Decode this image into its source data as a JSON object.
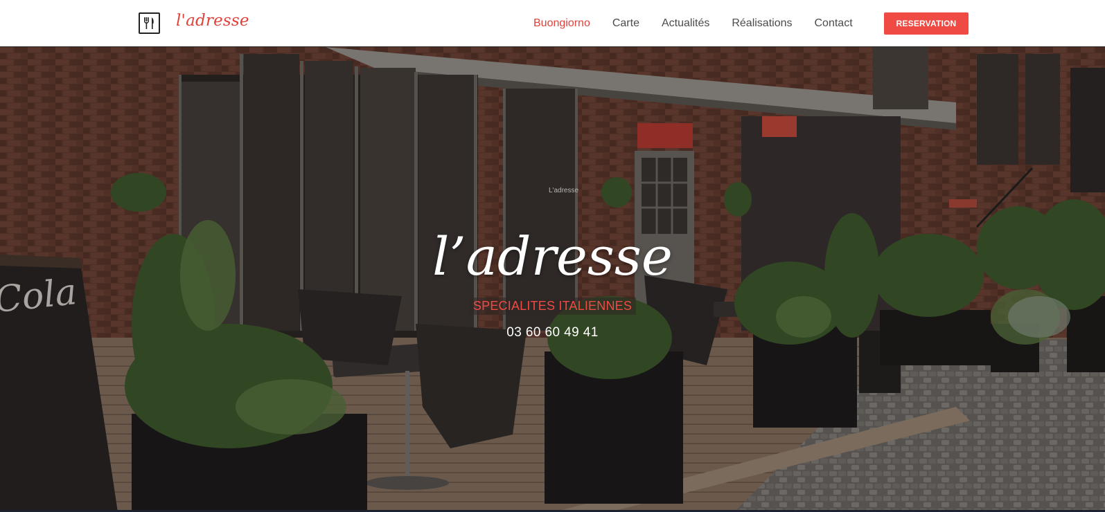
{
  "brand": {
    "name": "l'adresse",
    "logo_icon": "fork-knife-icon",
    "accent_color": "#ef4a43"
  },
  "nav": {
    "items": [
      {
        "label": "Buongiorno",
        "active": true
      },
      {
        "label": "Carte",
        "active": false
      },
      {
        "label": "Actualités",
        "active": false
      },
      {
        "label": "Réalisations",
        "active": false
      },
      {
        "label": "Contact",
        "active": false
      }
    ],
    "cta_label": "RESERVATION"
  },
  "hero": {
    "title": "l’adresse",
    "subtitle": "SPECIALITES ITALIENNES",
    "phone": "03 60 60 49 41",
    "sign_text": "Cola",
    "window_text": "L'adresse"
  }
}
